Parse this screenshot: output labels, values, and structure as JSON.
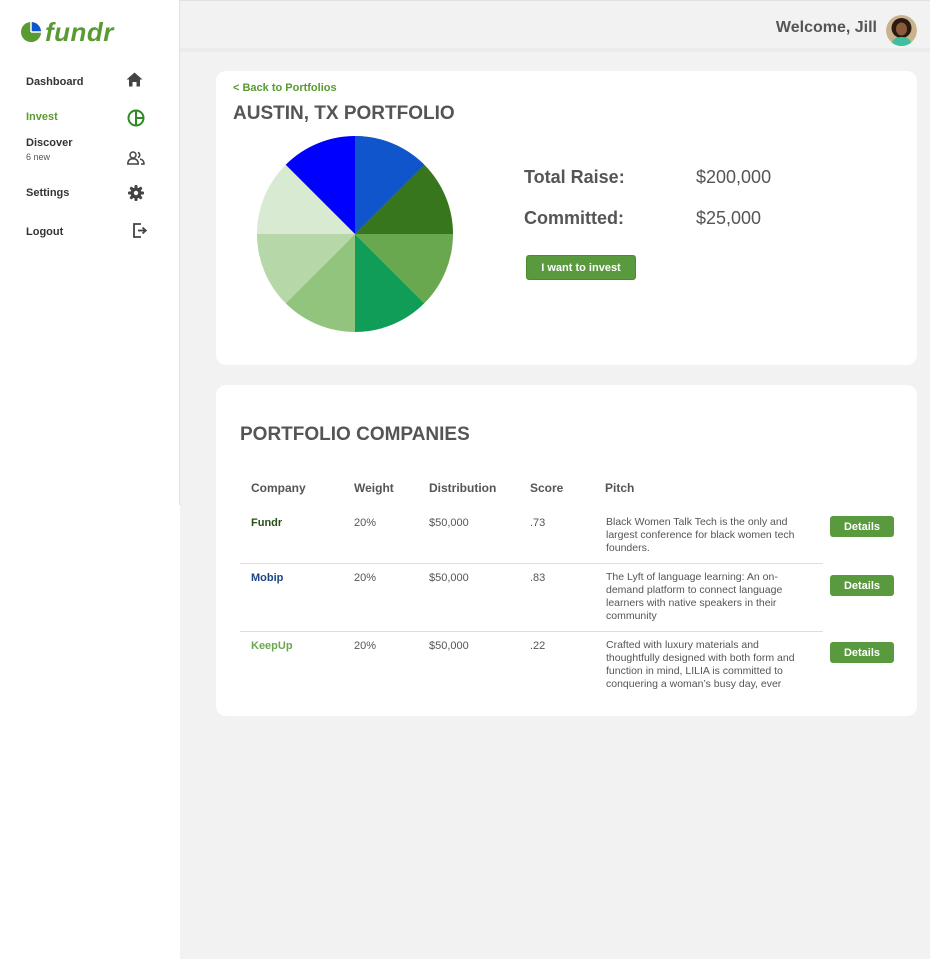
{
  "app": {
    "logo_text": "fundr"
  },
  "sidebar": {
    "items": [
      {
        "label": "Dashboard",
        "icon": "home-icon"
      },
      {
        "label": "Invest",
        "icon": "pie-chart-icon",
        "active": true
      },
      {
        "label": "Discover",
        "sublabel": "6 new",
        "icon": "people-icon"
      },
      {
        "label": "Settings",
        "icon": "gear-icon"
      },
      {
        "label": "Logout",
        "icon": "logout-icon"
      }
    ]
  },
  "header": {
    "welcome": "Welcome, Jill",
    "avatar": "user-avatar"
  },
  "portfolio": {
    "back_link": "< Back to Portfolios",
    "title": "AUSTIN, TX PORTFOLIO",
    "total_raise_label": "Total Raise:",
    "total_raise_value": "$200,000",
    "committed_label": "Committed:",
    "committed_value": "$25,000",
    "invest_button": "I want to invest",
    "pie_slices": [
      {
        "share": 0.125,
        "color": "#274e13"
      },
      {
        "share": 0.125,
        "color": "#38761d"
      },
      {
        "share": 0.125,
        "color": "#6aa84f"
      },
      {
        "share": 0.125,
        "color": "#0f9d58"
      },
      {
        "share": 0.125,
        "color": "#93c47d"
      },
      {
        "share": 0.125,
        "color": "#b6d7a8"
      },
      {
        "share": 0.125,
        "color": "#d9ead3"
      },
      {
        "share": 0.125,
        "color": "#0000ff"
      },
      {
        "share": 0.125,
        "color": "#1155cc"
      }
    ]
  },
  "companies": {
    "title": "PORTFOLIO COMPANIES",
    "columns": [
      "Company",
      "Weight",
      "Distribution",
      "Score",
      "Pitch"
    ],
    "details_label": "Details",
    "rows": [
      {
        "company": "Fundr",
        "company_color": "#274e13",
        "weight": "20%",
        "distribution": "$50,000",
        "score": ".73",
        "pitch": "Black Women Talk Tech is the only and largest conference for black women tech founders."
      },
      {
        "company": "Mobip",
        "company_color": "#1c4587",
        "weight": "20%",
        "distribution": "$50,000",
        "score": ".83",
        "pitch": "The Lyft of language learning: An on-demand platform to connect language learners with native speakers in their community"
      },
      {
        "company": "KeepUp",
        "company_color": "#6aa84f",
        "weight": "20%",
        "distribution": "$50,000",
        "score": ".22",
        "pitch": "Crafted with luxury materials and thoughtfully designed with both form and function in mind, LILIA is committed to conquering a woman’s busy day, ever"
      }
    ]
  },
  "colors": {
    "brand_green": "#5a9a32",
    "button_green": "#5a9a3e",
    "text_gray": "#555555"
  }
}
